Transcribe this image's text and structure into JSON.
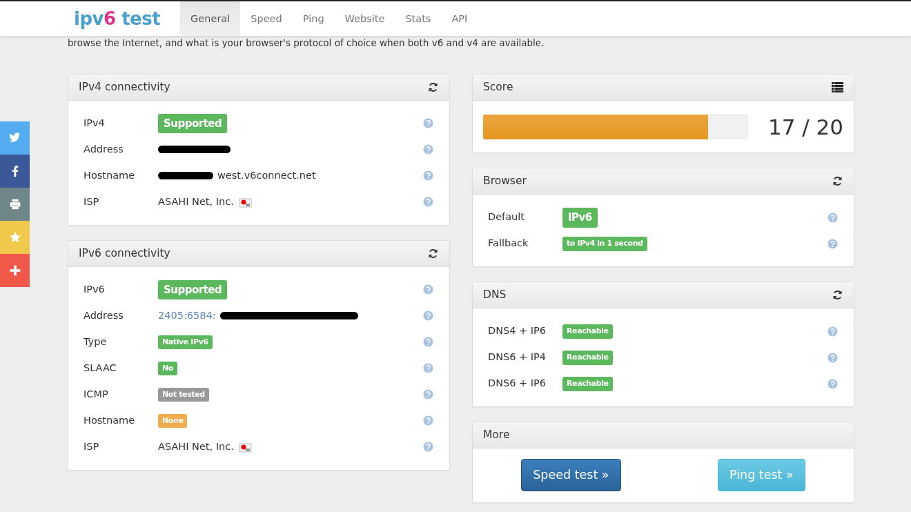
{
  "navbar": {
    "logo": {
      "part1": "ipv6",
      "part2": "test"
    },
    "tabs": [
      {
        "label": "General",
        "selected": true
      },
      {
        "label": "Speed",
        "selected": false
      },
      {
        "label": "Ping",
        "selected": false
      },
      {
        "label": "Website",
        "selected": false
      },
      {
        "label": "Stats",
        "selected": false
      },
      {
        "label": "API",
        "selected": false
      }
    ]
  },
  "intro": "browse the Internet, and what is your browser's protocol of choice when both v6 and v4 are available.",
  "social": [
    {
      "kind": "twitter"
    },
    {
      "kind": "facebook"
    },
    {
      "kind": "print"
    },
    {
      "kind": "star"
    },
    {
      "kind": "plus"
    }
  ],
  "left_panels": [
    {
      "title": "IPv4 connectivity",
      "rows": [
        {
          "label": "IPv4",
          "kind": "badge-large",
          "color": "#5cb85c",
          "value": "Supported"
        },
        {
          "label": "Address",
          "kind": "redacted-link"
        },
        {
          "label": "Hostname",
          "kind": "redacted-text",
          "value": "west.v6connect.net"
        },
        {
          "label": "ISP",
          "kind": "isp",
          "value": "ASAHI Net, Inc."
        }
      ]
    },
    {
      "title": "IPv6 connectivity",
      "rows": [
        {
          "label": "IPv6",
          "kind": "badge-large",
          "color": "#5cb85c",
          "value": "Supported"
        },
        {
          "label": "Address",
          "kind": "link-redacted",
          "value": "2405:6584:"
        },
        {
          "label": "Type",
          "kind": "badge-small",
          "color": "#5cb85c",
          "value": "Native IPv6"
        },
        {
          "label": "SLAAC",
          "kind": "badge-small",
          "color": "#5cb85c",
          "value": "No"
        },
        {
          "label": "ICMP",
          "kind": "badge-small",
          "color": "#999999",
          "value": "Not tested"
        },
        {
          "label": "Hostname",
          "kind": "badge-small",
          "color": "#f0ad4e",
          "value": "None"
        },
        {
          "label": "ISP",
          "kind": "isp",
          "value": "ASAHI Net, Inc."
        }
      ]
    }
  ],
  "score": {
    "title": "Score",
    "level": 0.85,
    "reading": "17 / 20"
  },
  "right_panels": [
    {
      "title": "Browser",
      "rows": [
        {
          "label": "Default",
          "kind": "badge-large",
          "color": "#5cb85c",
          "value": "IPv6"
        },
        {
          "label": "Fallback",
          "kind": "badge-small",
          "color": "#5cb85c",
          "value": "to IPv4 in 1 second"
        }
      ]
    },
    {
      "title": "DNS",
      "rows": [
        {
          "label": "DNS4 + IP6",
          "kind": "badge-small",
          "color": "#5cb85c",
          "value": "Reachable"
        },
        {
          "label": "DNS6 + IP4",
          "kind": "badge-small",
          "color": "#5cb85c",
          "value": "Reachable"
        },
        {
          "label": "DNS6 + IP6",
          "kind": "badge-small",
          "color": "#5cb85c",
          "value": "Reachable"
        }
      ]
    }
  ],
  "more": {
    "title": "More",
    "buttons": [
      {
        "label": "Speed test »",
        "kind": "primary"
      },
      {
        "label": "Ping test »",
        "kind": "info"
      }
    ]
  }
}
